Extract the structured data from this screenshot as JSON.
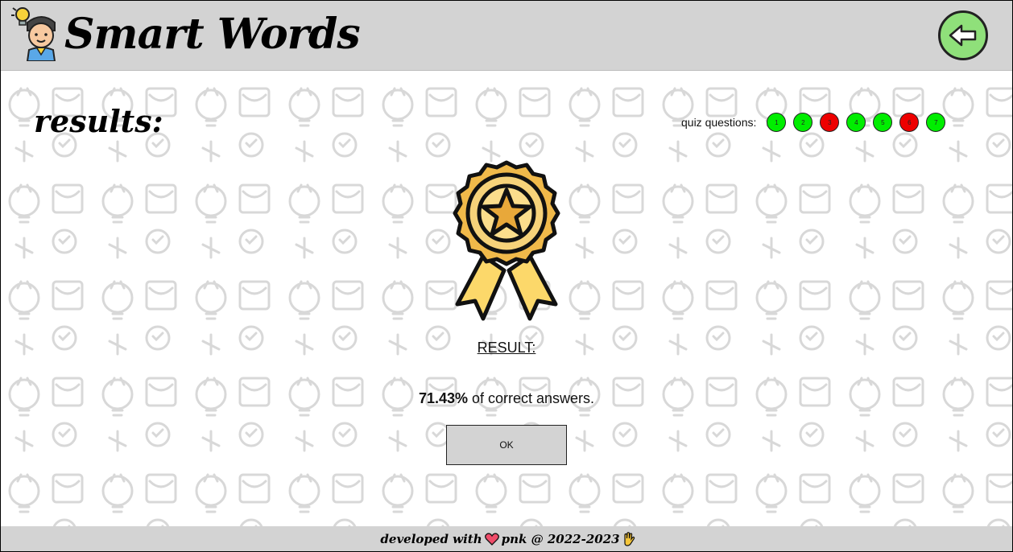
{
  "app": {
    "title": "Smart Words"
  },
  "header": {
    "back_icon": "arrow-left-icon",
    "back_color": "#8fe07a"
  },
  "page": {
    "title": "results:"
  },
  "quiz": {
    "label": "quiz questions:",
    "questions": [
      {
        "num": "1",
        "status": "correct"
      },
      {
        "num": "2",
        "status": "correct"
      },
      {
        "num": "3",
        "status": "wrong"
      },
      {
        "num": "4",
        "status": "correct"
      },
      {
        "num": "5",
        "status": "correct"
      },
      {
        "num": "6",
        "status": "wrong"
      },
      {
        "num": "7",
        "status": "correct"
      }
    ],
    "colors": {
      "correct": "#00ee00",
      "wrong": "#ee0000"
    }
  },
  "result": {
    "label": "RESULT:",
    "percent": "71.43%",
    "suffix": " of correct answers.",
    "ok_label": "OK"
  },
  "footer": {
    "prefix": "developed with",
    "heart_icon": "heart-icon",
    "suffix": "pnk @ 2022-2023",
    "hand_icon": "waving-hand-icon"
  }
}
